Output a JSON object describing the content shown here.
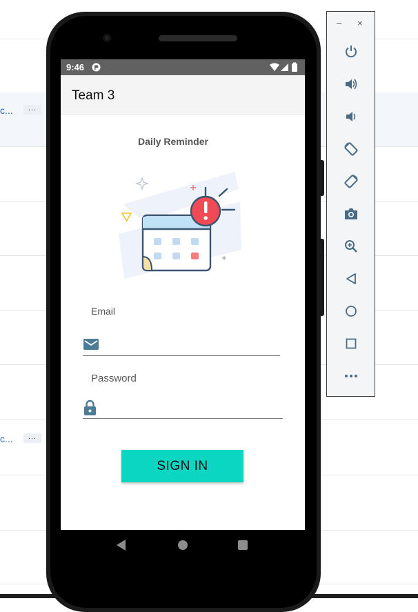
{
  "background_page": {
    "rows": [
      {
        "link_text": "c...",
        "more_label": "..."
      },
      {
        "link_text": "c...",
        "more_label": "..."
      }
    ]
  },
  "emulator_panel": {
    "minimize_label": "–",
    "close_label": "×",
    "tools": [
      "power-icon",
      "volume-up-icon",
      "volume-down-icon",
      "rotate-left-icon",
      "rotate-right-icon",
      "camera-icon",
      "zoom-icon",
      "back-icon",
      "home-icon",
      "overview-icon",
      "more-icon"
    ]
  },
  "status_bar": {
    "time": "9:46"
  },
  "app_bar": {
    "title": "Team 3"
  },
  "screen": {
    "heading": "Daily Reminder",
    "email": {
      "label": "Email",
      "value": ""
    },
    "password": {
      "label": "Password",
      "value": ""
    },
    "sign_in_label": "SIGN IN"
  },
  "colors": {
    "accent_button": "#0ad6c1",
    "icon_blue": "#4d7c99",
    "alert_red": "#f04a54"
  }
}
